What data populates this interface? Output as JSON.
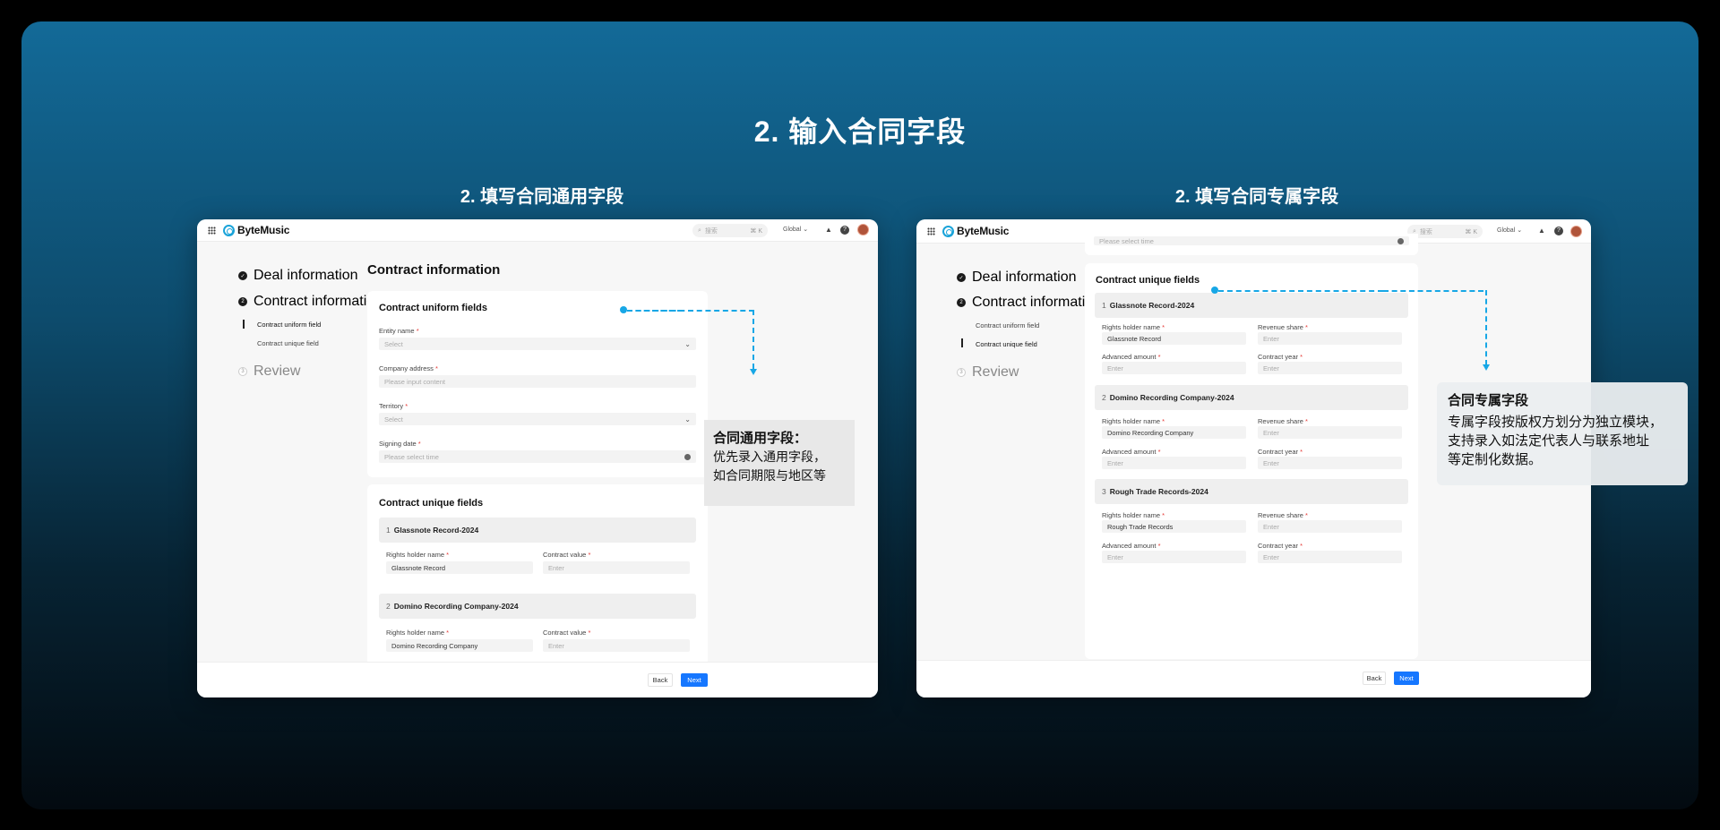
{
  "titles": {
    "main": "2. 输入合同字段",
    "left": "2. 填写合同通用字段",
    "right": "2. 填写合同专属字段"
  },
  "app": {
    "brand": "ByteMusic",
    "search_placeholder": "搜索",
    "search_shortcut": "⌘ K",
    "region": "Global",
    "region_chevron": "⌄"
  },
  "steps": {
    "deal": "Deal information",
    "contract": "Contract information",
    "contract_num": "2",
    "uniform": "Contract uniform field",
    "unique": "Contract unique field",
    "review": "Review",
    "review_num": "3"
  },
  "left": {
    "page_title": "Contract information",
    "uniform_title": "Contract uniform fields",
    "entity_label": "Entity name",
    "entity_value": "Select",
    "address_label": "Company address",
    "address_placeholder": "Please input content",
    "territory_label": "Territory",
    "territory_value": "Select",
    "signing_label": "Signing date",
    "signing_placeholder": "Please select time",
    "unique_title": "Contract unique fields",
    "sections": [
      {
        "num": "1",
        "name": "Glassnote Record-2024",
        "holder_label": "Rights holder name",
        "holder_value": "Glassnote Record",
        "value_label": "Contract value",
        "value_placeholder": "Enter"
      },
      {
        "num": "2",
        "name": "Domino Recording Company-2024",
        "holder_label": "Rights holder name",
        "holder_value": "Domino Recording Company",
        "value_label": "Contract value",
        "value_placeholder": "Enter"
      }
    ],
    "back": "Back",
    "next": "Next",
    "callout_title": "合同通用字段：",
    "callout_line1": "优先录入通用字段，",
    "callout_line2": "如合同期限与地区等"
  },
  "right": {
    "partial_input": "Please select time",
    "unique_title": "Contract unique fields",
    "sections": [
      {
        "num": "1",
        "name": "Glassnote Record-2024",
        "holder_label": "Rights holder name",
        "holder_value": "Glassnote Record",
        "share_label": "Revenue share",
        "share_placeholder": "Enter",
        "adv_label": "Advanced amount",
        "adv_placeholder": "Enter",
        "year_label": "Contract year",
        "year_placeholder": "Enter"
      },
      {
        "num": "2",
        "name": "Domino Recording Company-2024",
        "holder_label": "Rights holder name",
        "holder_value": "Domino Recording Company",
        "share_label": "Revenue share",
        "share_placeholder": "Enter",
        "adv_label": "Advanced amount",
        "adv_placeholder": "Enter",
        "year_label": "Contract year",
        "year_placeholder": "Enter"
      },
      {
        "num": "3",
        "name": "Rough Trade Records-2024",
        "holder_label": "Rights holder name",
        "holder_value": "Rough Trade Records",
        "share_label": "Revenue share",
        "share_placeholder": "Enter",
        "adv_label": "Advanced amount",
        "adv_placeholder": "Enter",
        "year_label": "Contract year",
        "year_placeholder": "Enter"
      }
    ],
    "back": "Back",
    "next": "Next",
    "callout_title": "合同专属字段",
    "callout_line1": "专属字段按版权方划分为独立模块，",
    "callout_line2": "支持录入如法定代表人与联系地址",
    "callout_line3": "等定制化数据。"
  },
  "icons": {
    "search": "⌕",
    "bell": "🔔",
    "help": "?",
    "check": "✓",
    "chevron_down": "⌄"
  },
  "colors": {
    "accent": "#1677ff",
    "dashed_line": "#17a7e6",
    "required": "#e53935"
  }
}
